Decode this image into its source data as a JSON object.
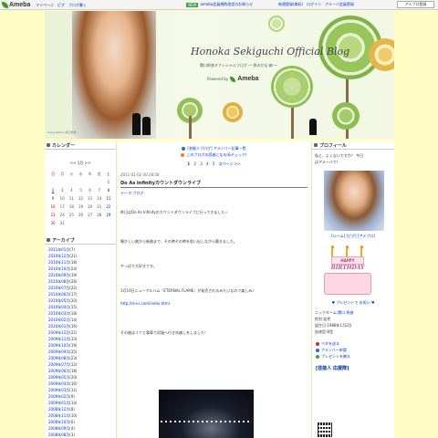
{
  "topbar": {
    "logo": "Ameba",
    "nav": [
      "マイページ",
      "ピグ",
      "ブログ書く"
    ],
    "new_badge": "NEW",
    "notice": "ameba会員規約改定のお知らせ",
    "right": [
      "新規登録(無料)",
      "ログイン",
      "アメーバ会員登録"
    ],
    "fav_button": "アメブロ登録"
  },
  "header": {
    "title": "Honoka Sekiguchi Official Blog",
    "subtitle": "関口帆香オフィシャルブログ ～ 帆のかな 森 ～",
    "powered_by": "Powered by",
    "powered_brand": "Ameba",
    "photo_caption": "Copyright(c) 関口帆香"
  },
  "calendar": {
    "heading": "カレンダー",
    "nav": "<< 1月 >>",
    "weekdays": [
      "日",
      "月",
      "火",
      "水",
      "木",
      "金",
      "土"
    ],
    "weeks": [
      [
        "",
        "",
        "",
        "",
        "",
        "",
        "1"
      ],
      [
        "2",
        "3",
        "4",
        "5",
        "6",
        "7",
        "8"
      ],
      [
        "9",
        "10",
        "11",
        "12",
        "13",
        "14",
        "15"
      ],
      [
        "16",
        "17",
        "18",
        "19",
        "20",
        "21",
        "22"
      ],
      [
        "23",
        "24",
        "25",
        "26",
        "27",
        "28",
        "29"
      ],
      [
        "30",
        "31",
        "",
        "",
        "",
        "",
        ""
      ]
    ]
  },
  "archives": {
    "heading": "アーカイブ",
    "items": [
      {
        "label": "2011年01月",
        "count": "(7)"
      },
      {
        "label": "2010年12月",
        "count": "(21)"
      },
      {
        "label": "2010年11月",
        "count": "(18)"
      },
      {
        "label": "2010年10月",
        "count": "(24)"
      },
      {
        "label": "2010年09月",
        "count": "(19)"
      },
      {
        "label": "2010年08月",
        "count": "(26)"
      },
      {
        "label": "2010年07月",
        "count": "(22)"
      },
      {
        "label": "2010年06月",
        "count": "(17)"
      },
      {
        "label": "2010年05月",
        "count": "(20)"
      },
      {
        "label": "2010年04月",
        "count": "(15)"
      },
      {
        "label": "2010年03月",
        "count": "(18)"
      },
      {
        "label": "2010年02月",
        "count": "(14)"
      },
      {
        "label": "2010年01月",
        "count": "(16)"
      },
      {
        "label": "2009年12月",
        "count": "(21)"
      },
      {
        "label": "2009年11月",
        "count": "(13)"
      },
      {
        "label": "2009年10月",
        "count": "(19)"
      },
      {
        "label": "2009年09月",
        "count": "(25)"
      },
      {
        "label": "2009年08月",
        "count": "(23)"
      },
      {
        "label": "2009年07月",
        "count": "(12)"
      },
      {
        "label": "2009年06月",
        "count": "(18)"
      },
      {
        "label": "2009年05月",
        "count": "(20)"
      },
      {
        "label": "2009年04月",
        "count": "(16)"
      },
      {
        "label": "2009年03月",
        "count": "(11)"
      },
      {
        "label": "2009年02月",
        "count": "(9)"
      },
      {
        "label": "2009年01月",
        "count": "(14)"
      },
      {
        "label": "2008年12月",
        "count": "(8)"
      },
      {
        "label": "2008年11月",
        "count": "(10)"
      },
      {
        "label": "2008年10月",
        "count": "(6)"
      },
      {
        "label": "2008年09月",
        "count": "(4)"
      },
      {
        "label": "2008年08月",
        "count": "(3)"
      }
    ]
  },
  "center": {
    "theme1": "[芸能人ブログ] アメンバー記事一覧",
    "theme2": "このブログの読者になる(&チェック)",
    "pager": {
      "current": "1",
      "pages": [
        "2",
        "3",
        "4",
        "5"
      ],
      "next": "次ページ >>"
    },
    "entry": {
      "date": "2011-01-02 00:28:58",
      "title": "Do As Infinityカウントダウンライブ",
      "theme": "テーマ:ブログ",
      "body": [
        "昨日はDo As Infinityのカウントダウンライブに行ってきました☆",
        "懐かしい曲から新曲まで、その時その時を思い出しながら聴きました。",
        "やっぱり大好きです。",
        "1月19日ニューアルバム『ETERNAL FLAME』が発売されるみたいなので楽しみ♪",
        "http://d-a-i.com/index.html",
        "その後はリナと電車で初詣へ行き年越しをしました！"
      ]
    }
  },
  "profile": {
    "heading": "プロフィール",
    "line1": "私と、よくないですか？ 今日",
    "line2": "はアメーバで！",
    "links": "[ルーム] [ピグ] [アメブロ]",
    "cake_text": "HAPPY",
    "cake_text2": "BIRTHDAY",
    "present": "♥ プレゼントで お祝い ♥",
    "info": [
      {
        "label": "ニックネーム:",
        "value": "関口 帆香"
      },
      {
        "label": "性別:",
        "value": "女性"
      },
      {
        "label": "誕生日:",
        "value": "1988年1月2日"
      },
      {
        "label": "血液型:",
        "value": "B型"
      }
    ],
    "right_links": [
      {
        "label": "ペタを送る",
        "color": "red"
      },
      {
        "label": "アメンバー申請",
        "color": "blue"
      },
      {
        "label": "プレゼントを贈る",
        "color": "grn"
      }
    ],
    "fans": "[芸能人 応援隊]"
  }
}
